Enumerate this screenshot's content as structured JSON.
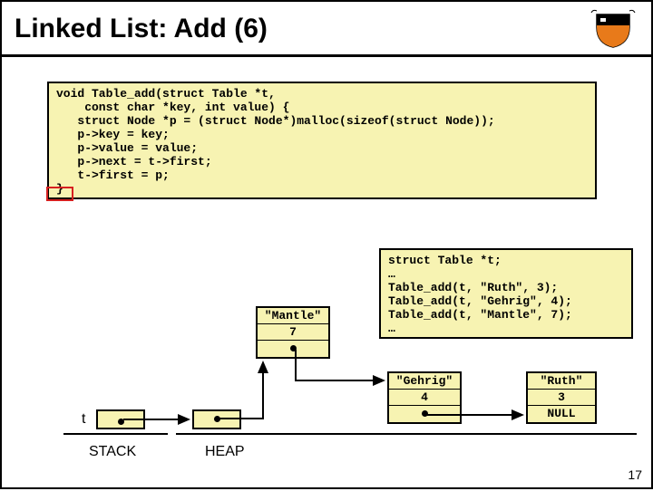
{
  "title": "Linked List: Add (6)",
  "code_main": "void Table_add(struct Table *t,\n    const char *key, int value) {\n   struct Node *p = (struct Node*)malloc(sizeof(struct Node));\n   p->key = key;\n   p->value = value;\n   p->next = t->first;\n   t->first = p;\n}",
  "code_right": "struct Table *t;\n…\nTable_add(t, \"Ruth\", 3);\nTable_add(t, \"Gehrig\", 4);\nTable_add(t, \"Mantle\", 7);\n…",
  "nodes": {
    "mantle": {
      "key": "\"Mantle\"",
      "value": "7"
    },
    "gehrig": {
      "key": "\"Gehrig\"",
      "value": "4"
    },
    "ruth": {
      "key": "\"Ruth\"",
      "value": "3",
      "next": "NULL"
    }
  },
  "labels": {
    "t": "t",
    "stack": "STACK",
    "heap": "HEAP"
  },
  "page": "17"
}
